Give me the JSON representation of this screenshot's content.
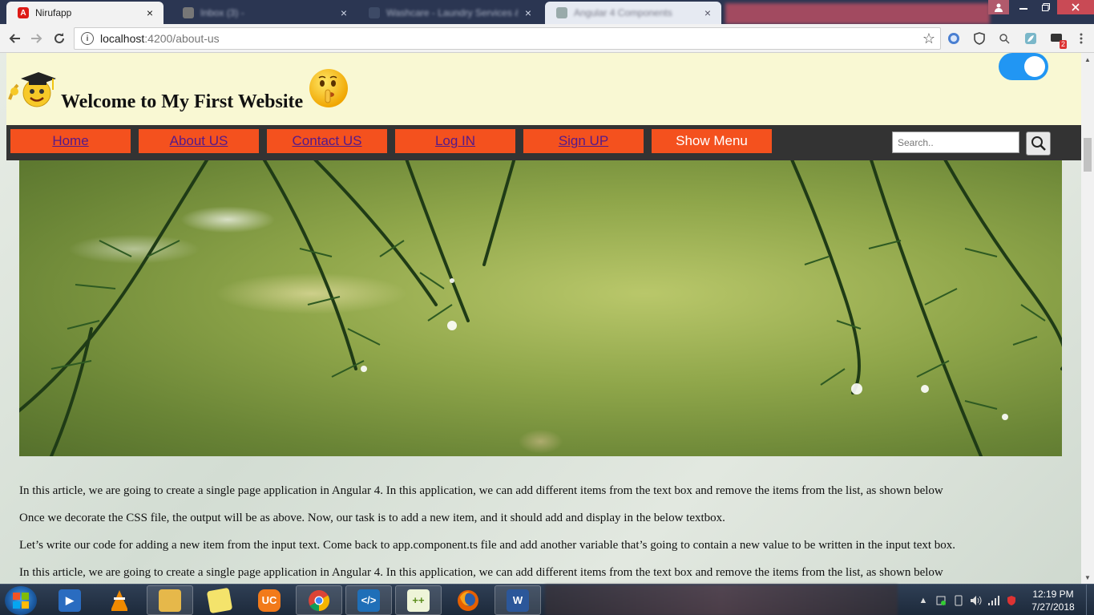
{
  "browser": {
    "tabs": [
      {
        "title": "Nirufapp",
        "active": true
      },
      {
        "title": "Inbox (3) - ",
        "active": false
      },
      {
        "title": "Washcare - Laundry Services & ",
        "active": false
      },
      {
        "title": "Angular 4 Components",
        "active": false
      }
    ],
    "tab_close_glyph": "×",
    "url_host": "localhost",
    "url_path": ":4200/about-us"
  },
  "page": {
    "site_title": "Welcome to My First Website",
    "nav_items": [
      "Home",
      "About US",
      "Contact US",
      "Log IN",
      "Sign UP"
    ],
    "menu_button": "Show Menu",
    "search_placeholder": "Search..",
    "toggle_on": true,
    "paragraphs": [
      "In this article, we are going to create a single page application in Angular 4. In this application, we can add different items from the text box and remove the items from the list, as shown below",
      "Once we decorate the CSS file, the output will be as above. Now, our task is to add a new item, and it should add and display in the below textbox.",
      "Let’s write our code for adding a new item from the input text. Come back to app.component.ts file and add another variable that’s going to contain a new value to be written in the input text box.",
      "In this article, we are going to create a single page application in Angular 4. In this application, we can add different items from the text box and remove the items from the list, as shown below"
    ]
  },
  "taskbar": {
    "apps": [
      "media-player",
      "vlc",
      "file-explorer",
      "sticky-notes",
      "uc-browser",
      "chrome",
      "visual-studio-code",
      "notepad-plus-plus",
      "firefox",
      "word"
    ],
    "time": "12:19 PM",
    "date": "7/27/2018"
  },
  "colors": {
    "header_bg": "#f9f8d3",
    "navbar_bg": "#333333",
    "nav_button": "#f4511e",
    "toggle": "#2196f3"
  }
}
